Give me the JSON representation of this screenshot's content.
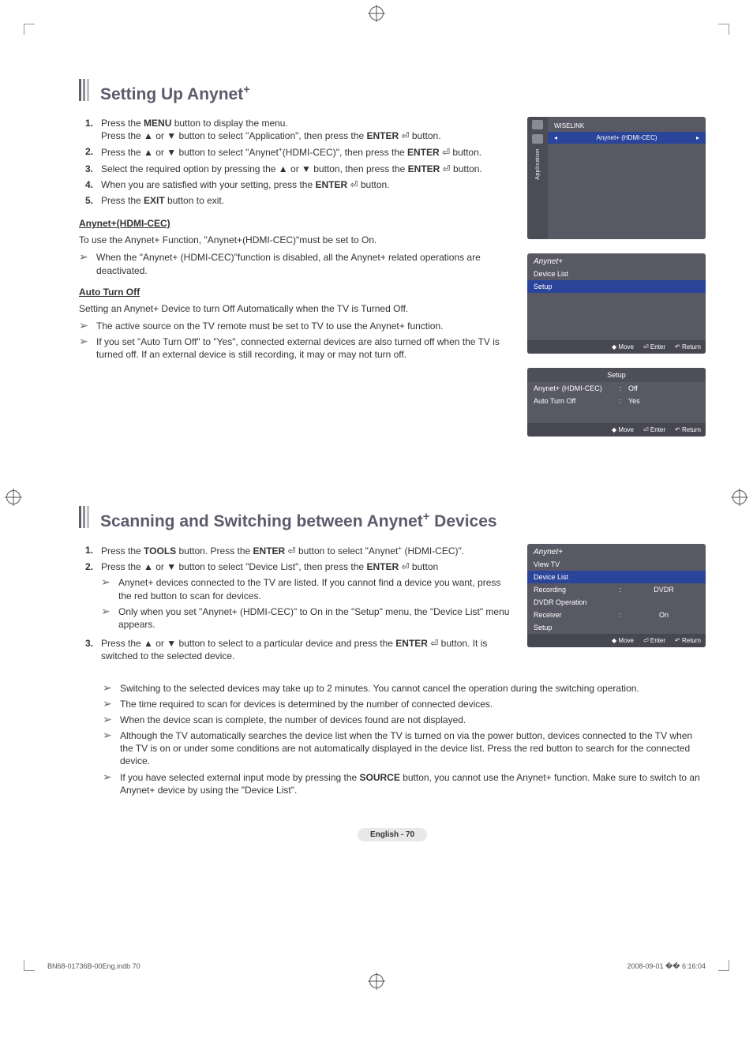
{
  "section1": {
    "title_pre": "Setting Up Anynet",
    "title_sup": "+",
    "steps": [
      {
        "n": "1.",
        "html": "Press the <b>MENU</b> button to display the menu.<br>Press the ▲ or ▼ button to select \"Application\", then press the <b>ENTER</b> ⏎ button."
      },
      {
        "n": "2.",
        "html": "Press the ▲ or ▼ button to select \"Anynet<sup>+</sup>(HDMI-CEC)\", then press the <b>ENTER</b> ⏎ button."
      },
      {
        "n": "3.",
        "html": "Select the required option by pressing the ▲ or ▼ button, then press the <b>ENTER</b> ⏎ button."
      },
      {
        "n": "4.",
        "html": "When you are satisfied with your setting, press the <b>ENTER</b> ⏎ button."
      },
      {
        "n": "5.",
        "html": "Press the <b>EXIT</b> button to exit."
      }
    ],
    "sub1_h": "Anynet+(HDMI-CEC)",
    "sub1_para": "To use the Anynet+ Function, \"Anynet+(HDMI-CEC)\"must be set to On.",
    "sub1_note": "When the \"Anynet+ (HDMI-CEC)\"function is disabled, all the Anynet+ related operations are deactivated.",
    "sub2_h": "Auto Turn Off",
    "sub2_para": "Setting an Anynet+ Device to turn Off Automatically when the TV is Turned Off.",
    "sub2_notes": [
      "The active source on the TV remote must be set to TV to use the Anynet+ function.",
      "If you set \"Auto Turn Off\" to \"Yes\", connected external devices are also turned off when the TV is turned off. If an external device is still recording, it may or may not turn off."
    ]
  },
  "osd_app": {
    "sidebar_label": "Application",
    "row1": "WISELINK",
    "row2": "Anynet+ (HDMI-CEC)"
  },
  "osd_anynet": {
    "header": "Anynet+",
    "items": [
      "Device List",
      "Setup"
    ],
    "footer": {
      "move": "Move",
      "enter": "Enter",
      "return": "Return"
    }
  },
  "osd_setup": {
    "title": "Setup",
    "rows": [
      {
        "k": "Anynet+ (HDMI-CEC)",
        "v": "Off"
      },
      {
        "k": "Auto Turn Off",
        "v": "Yes"
      }
    ],
    "footer": {
      "move": "Move",
      "enter": "Enter",
      "return": "Return"
    }
  },
  "section2": {
    "title_pre": "Scanning and Switching between Anynet",
    "title_sup": "+",
    "title_post": " Devices",
    "steps": [
      {
        "n": "1.",
        "html": "Press the <b>TOOLS</b> button. Press the <b>ENTER</b> ⏎ button to select \"Anynet<sup>+</sup> (HDMI-CEC)\"."
      },
      {
        "n": "2.",
        "html": "Press the ▲ or ▼ button to select \"Device List\", then press the <b>ENTER</b> ⏎ button"
      },
      {
        "n": "3.",
        "html": "Press the ▲ or ▼ button to select to a particular device and press the <b>ENTER</b> ⏎ button. It is switched to the selected device."
      }
    ],
    "step2_subs": [
      "Anynet+ devices connected to the TV are listed. If you cannot find a device you want, press the red button to scan for devices.",
      "Only when you set \"Anynet+ (HDMI-CEC)\" to On in the \"Setup\" menu, the \"Device List\" menu appears."
    ],
    "notes_after": [
      "Switching to the selected devices may take up to 2 minutes. You cannot cancel the operation during the switching operation.",
      "The time required to scan for devices is determined by the number of connected devices.",
      "When the device scan is complete, the number of devices found are not displayed.",
      "Although the TV automatically searches the device list when the TV is turned on via the power button, devices connected to the TV when the TV is on or under some conditions are not automatically displayed in the device list. Press the red button to search for the connected device.",
      "If you have selected external input mode by pressing the <b>SOURCE</b> button, you cannot use the Anynet+ function. Make sure to switch to an Anynet+ device by using the \"Device List\"."
    ]
  },
  "osd_list": {
    "header": "Anynet+",
    "rows": [
      {
        "label": "View TV",
        "val": ""
      },
      {
        "label": "Device List",
        "val": "",
        "sel": true
      },
      {
        "label": "Recording",
        "col": ":",
        "val": "DVDR"
      },
      {
        "label": "DVDR Operation",
        "val": ""
      },
      {
        "label": "Receiver",
        "col": ":",
        "val": "On"
      },
      {
        "label": "Setup",
        "val": ""
      }
    ],
    "footer": {
      "move": "Move",
      "enter": "Enter",
      "return": "Return"
    }
  },
  "page_num": "English - 70",
  "foot_left": "BN68-01736B-00Eng.indb   70",
  "foot_right": "2008-09-01   �� 6:16:04"
}
